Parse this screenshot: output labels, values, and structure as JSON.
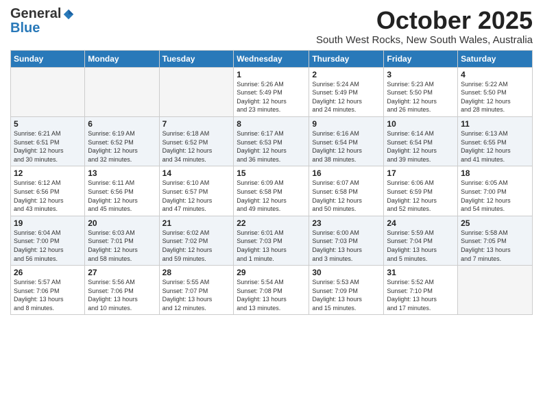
{
  "logo": {
    "general": "General",
    "blue": "Blue"
  },
  "title": "October 2025",
  "subtitle": "South West Rocks, New South Wales, Australia",
  "header_days": [
    "Sunday",
    "Monday",
    "Tuesday",
    "Wednesday",
    "Thursday",
    "Friday",
    "Saturday"
  ],
  "weeks": [
    {
      "days": [
        {
          "num": "",
          "info": ""
        },
        {
          "num": "",
          "info": ""
        },
        {
          "num": "",
          "info": ""
        },
        {
          "num": "1",
          "info": "Sunrise: 5:26 AM\nSunset: 5:49 PM\nDaylight: 12 hours\nand 23 minutes."
        },
        {
          "num": "2",
          "info": "Sunrise: 5:24 AM\nSunset: 5:49 PM\nDaylight: 12 hours\nand 24 minutes."
        },
        {
          "num": "3",
          "info": "Sunrise: 5:23 AM\nSunset: 5:50 PM\nDaylight: 12 hours\nand 26 minutes."
        },
        {
          "num": "4",
          "info": "Sunrise: 5:22 AM\nSunset: 5:50 PM\nDaylight: 12 hours\nand 28 minutes."
        }
      ]
    },
    {
      "days": [
        {
          "num": "5",
          "info": "Sunrise: 6:21 AM\nSunset: 6:51 PM\nDaylight: 12 hours\nand 30 minutes."
        },
        {
          "num": "6",
          "info": "Sunrise: 6:19 AM\nSunset: 6:52 PM\nDaylight: 12 hours\nand 32 minutes."
        },
        {
          "num": "7",
          "info": "Sunrise: 6:18 AM\nSunset: 6:52 PM\nDaylight: 12 hours\nand 34 minutes."
        },
        {
          "num": "8",
          "info": "Sunrise: 6:17 AM\nSunset: 6:53 PM\nDaylight: 12 hours\nand 36 minutes."
        },
        {
          "num": "9",
          "info": "Sunrise: 6:16 AM\nSunset: 6:54 PM\nDaylight: 12 hours\nand 38 minutes."
        },
        {
          "num": "10",
          "info": "Sunrise: 6:14 AM\nSunset: 6:54 PM\nDaylight: 12 hours\nand 39 minutes."
        },
        {
          "num": "11",
          "info": "Sunrise: 6:13 AM\nSunset: 6:55 PM\nDaylight: 12 hours\nand 41 minutes."
        }
      ]
    },
    {
      "days": [
        {
          "num": "12",
          "info": "Sunrise: 6:12 AM\nSunset: 6:56 PM\nDaylight: 12 hours\nand 43 minutes."
        },
        {
          "num": "13",
          "info": "Sunrise: 6:11 AM\nSunset: 6:56 PM\nDaylight: 12 hours\nand 45 minutes."
        },
        {
          "num": "14",
          "info": "Sunrise: 6:10 AM\nSunset: 6:57 PM\nDaylight: 12 hours\nand 47 minutes."
        },
        {
          "num": "15",
          "info": "Sunrise: 6:09 AM\nSunset: 6:58 PM\nDaylight: 12 hours\nand 49 minutes."
        },
        {
          "num": "16",
          "info": "Sunrise: 6:07 AM\nSunset: 6:58 PM\nDaylight: 12 hours\nand 50 minutes."
        },
        {
          "num": "17",
          "info": "Sunrise: 6:06 AM\nSunset: 6:59 PM\nDaylight: 12 hours\nand 52 minutes."
        },
        {
          "num": "18",
          "info": "Sunrise: 6:05 AM\nSunset: 7:00 PM\nDaylight: 12 hours\nand 54 minutes."
        }
      ]
    },
    {
      "days": [
        {
          "num": "19",
          "info": "Sunrise: 6:04 AM\nSunset: 7:00 PM\nDaylight: 12 hours\nand 56 minutes."
        },
        {
          "num": "20",
          "info": "Sunrise: 6:03 AM\nSunset: 7:01 PM\nDaylight: 12 hours\nand 58 minutes."
        },
        {
          "num": "21",
          "info": "Sunrise: 6:02 AM\nSunset: 7:02 PM\nDaylight: 12 hours\nand 59 minutes."
        },
        {
          "num": "22",
          "info": "Sunrise: 6:01 AM\nSunset: 7:03 PM\nDaylight: 13 hours\nand 1 minute."
        },
        {
          "num": "23",
          "info": "Sunrise: 6:00 AM\nSunset: 7:03 PM\nDaylight: 13 hours\nand 3 minutes."
        },
        {
          "num": "24",
          "info": "Sunrise: 5:59 AM\nSunset: 7:04 PM\nDaylight: 13 hours\nand 5 minutes."
        },
        {
          "num": "25",
          "info": "Sunrise: 5:58 AM\nSunset: 7:05 PM\nDaylight: 13 hours\nand 7 minutes."
        }
      ]
    },
    {
      "days": [
        {
          "num": "26",
          "info": "Sunrise: 5:57 AM\nSunset: 7:06 PM\nDaylight: 13 hours\nand 8 minutes."
        },
        {
          "num": "27",
          "info": "Sunrise: 5:56 AM\nSunset: 7:06 PM\nDaylight: 13 hours\nand 10 minutes."
        },
        {
          "num": "28",
          "info": "Sunrise: 5:55 AM\nSunset: 7:07 PM\nDaylight: 13 hours\nand 12 minutes."
        },
        {
          "num": "29",
          "info": "Sunrise: 5:54 AM\nSunset: 7:08 PM\nDaylight: 13 hours\nand 13 minutes."
        },
        {
          "num": "30",
          "info": "Sunrise: 5:53 AM\nSunset: 7:09 PM\nDaylight: 13 hours\nand 15 minutes."
        },
        {
          "num": "31",
          "info": "Sunrise: 5:52 AM\nSunset: 7:10 PM\nDaylight: 13 hours\nand 17 minutes."
        },
        {
          "num": "",
          "info": ""
        }
      ]
    }
  ]
}
